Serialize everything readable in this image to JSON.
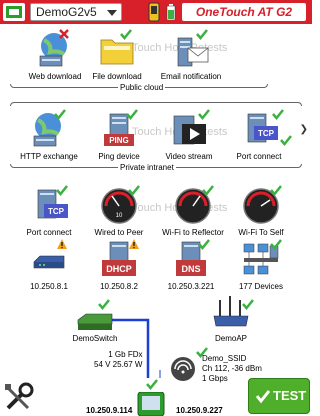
{
  "header": {
    "profile": "DemoG2v5",
    "title": "OneTouch AT G2"
  },
  "watermark": "Touch Hold Retests",
  "groups": {
    "public_cloud": "Public cloud",
    "private_intranet": "Private intranet"
  },
  "row1": [
    {
      "label": "Web download",
      "status": "fail"
    },
    {
      "label": "File download",
      "status": "pass"
    },
    {
      "label": "Email notification",
      "status": "pass"
    }
  ],
  "row2": [
    {
      "label": "HTTP exchange",
      "status": "pass"
    },
    {
      "label": "Ping device",
      "status": "pass",
      "icon_text": "PING"
    },
    {
      "label": "Video stream",
      "status": "pass"
    },
    {
      "label": "Port connect",
      "status": "pass",
      "icon_text": "TCP"
    }
  ],
  "row3": [
    {
      "label": "Port connect",
      "status": "pass",
      "icon_text": "TCP"
    },
    {
      "label": "Wired to Peer",
      "status": "pass"
    },
    {
      "label": "Wi-Fi to Reflector",
      "status": "pass"
    },
    {
      "label": "Wi-Fi To Self",
      "status": "pass"
    }
  ],
  "row4": [
    {
      "label": "10.250.8.1",
      "status": "warn"
    },
    {
      "label": "10.250.8.2",
      "status": "warn",
      "icon_text": "DHCP"
    },
    {
      "label": "10.250.3.221",
      "status": "pass",
      "icon_text": "DNS"
    },
    {
      "label": "177 Devices",
      "status": "pass"
    }
  ],
  "topology": {
    "switch_label": "DemoSwitch",
    "ap_label": "DemoAP",
    "wired_speed": "1 Gb FDx",
    "wired_power": "54 V 25.67 W",
    "ssid": "Demo_SSID",
    "channel": "Ch 112, -36 dBm",
    "wifi_rate": "1 Gbps",
    "wired_ip": "10.250.9.114",
    "wifi_ip": "10.250.9.227"
  },
  "test_button": "TEST",
  "colors": {
    "header": "#d8202a",
    "pass": "#3cb043",
    "fail": "#d8202a",
    "warn": "#f0a020",
    "link": "#1a3fd6",
    "test": "#4fae2a"
  }
}
